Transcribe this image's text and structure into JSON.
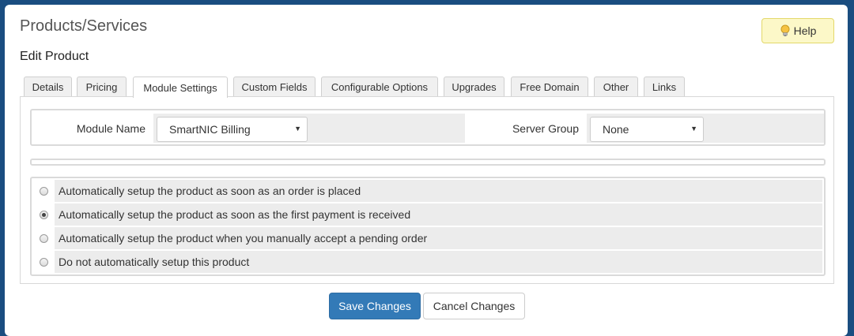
{
  "page": {
    "title": "Products/Services",
    "subtitle": "Edit Product",
    "help_label": "Help"
  },
  "tabs": [
    {
      "label": "Details"
    },
    {
      "label": "Pricing"
    },
    {
      "label": "Module Settings",
      "active": true
    },
    {
      "label": "Custom Fields"
    },
    {
      "label": "Configurable Options"
    },
    {
      "label": "Upgrades"
    },
    {
      "label": "Free Domain"
    },
    {
      "label": "Other"
    },
    {
      "label": "Links"
    }
  ],
  "module": {
    "module_name_label": "Module Name",
    "module_name_value": "SmartNIC Billing",
    "server_group_label": "Server Group",
    "server_group_value": "None"
  },
  "setup_options": [
    {
      "label": "Automatically setup the product as soon as an order is placed",
      "checked": false
    },
    {
      "label": "Automatically setup the product as soon as the first payment is received",
      "checked": true
    },
    {
      "label": "Automatically setup the product when you manually accept a pending order",
      "checked": false
    },
    {
      "label": "Do not automatically setup this product",
      "checked": false
    }
  ],
  "actions": {
    "save_label": "Save Changes",
    "cancel_label": "Cancel Changes"
  },
  "colors": {
    "primary": "#337ab7",
    "help_bg": "#fcf8c8",
    "frame": "#1a4d80"
  }
}
